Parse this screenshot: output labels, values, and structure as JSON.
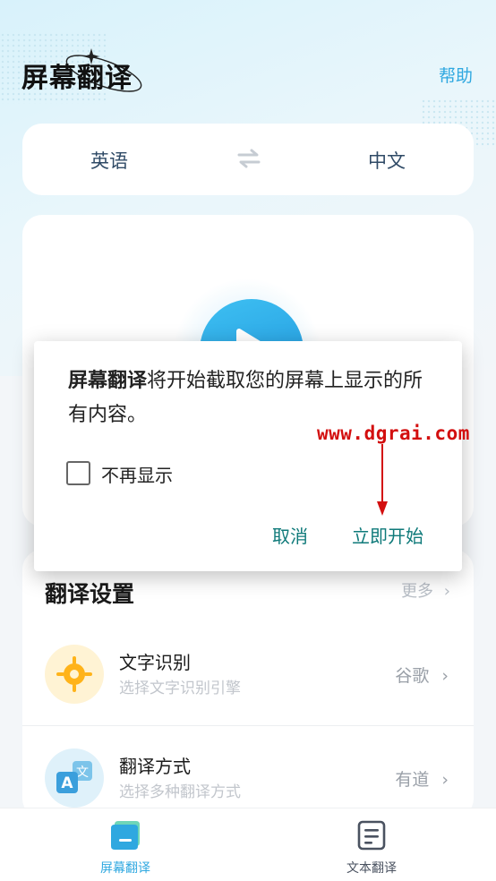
{
  "header": {
    "title": "屏幕翻译",
    "help_label": "帮助"
  },
  "language": {
    "source": "英语",
    "target": "中文"
  },
  "settings": {
    "title": "翻译设置",
    "more_label": "更多",
    "items": [
      {
        "title": "文字识别",
        "subtitle": "选择文字识别引擎",
        "value": "谷歌"
      },
      {
        "title": "翻译方式",
        "subtitle": "选择多种翻译方式",
        "value": "有道"
      }
    ]
  },
  "dialog": {
    "app_name": "屏幕翻译",
    "message": "将开始截取您的屏幕上显示的所有内容。",
    "checkbox_label": "不再显示",
    "cancel_label": "取消",
    "confirm_label": "立即开始"
  },
  "watermark": "www.dgrai.com",
  "nav": {
    "items": [
      {
        "label": "屏幕翻译",
        "active": true
      },
      {
        "label": "文本翻译",
        "active": false
      }
    ]
  },
  "colors": {
    "accent": "#2fa8e0",
    "dialog_button": "#0f7a7a",
    "watermark": "#d30f0f"
  }
}
